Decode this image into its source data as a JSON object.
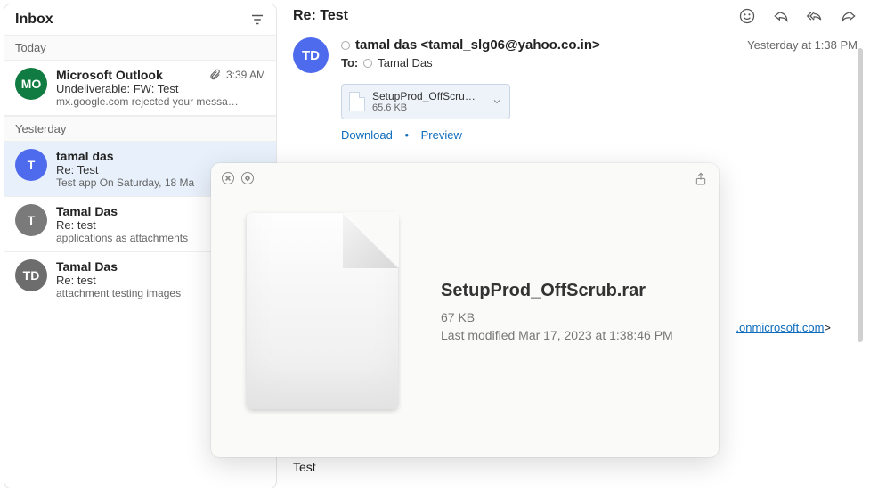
{
  "sidebar": {
    "title": "Inbox",
    "sections": [
      {
        "label": "Today",
        "items": [
          {
            "avatar_text": "MO",
            "avatar_class": "green",
            "sender": "Microsoft Outlook",
            "has_attachment": true,
            "time": "3:39 AM",
            "subject": "Undeliverable: FW: Test",
            "preview": "mx.google.com rejected your messa…",
            "selected": false
          }
        ]
      },
      {
        "label": "Yesterday",
        "items": [
          {
            "avatar_text": "T",
            "avatar_class": "blue",
            "sender": "tamal das",
            "has_attachment": false,
            "time": "",
            "subject": "Re: Test",
            "preview": "Test app On Saturday, 18 Ma",
            "selected": true
          },
          {
            "avatar_text": "T",
            "avatar_class": "grey",
            "sender": "Tamal Das",
            "has_attachment": false,
            "time": "",
            "subject": "Re: test",
            "preview": "applications as attachments",
            "selected": false
          },
          {
            "avatar_text": "TD",
            "avatar_class": "darkgrey",
            "sender": "Tamal Das",
            "has_attachment": false,
            "time": "",
            "subject": "Re: test",
            "preview": "attachment testing images",
            "selected": false
          }
        ]
      }
    ]
  },
  "reader": {
    "subject": "Re: Test",
    "from_avatar": "TD",
    "from_name": "tamal das <tamal_slg06@yahoo.co.in>",
    "to_label": "To:",
    "to_name": "Tamal Das",
    "date": "Yesterday at 1:38 PM",
    "attachment": {
      "name": "SetupProd_OffScrub…",
      "size": "65.6 KB"
    },
    "download_label": "Download",
    "preview_label": "Preview",
    "visible_link_text": ".onmicrosoft.com",
    "body": "Test"
  },
  "quicklook": {
    "filename": "SetupProd_OffScrub.rar",
    "size": "67 KB",
    "modified": "Last modified Mar 17, 2023 at 1:38:46 PM"
  }
}
